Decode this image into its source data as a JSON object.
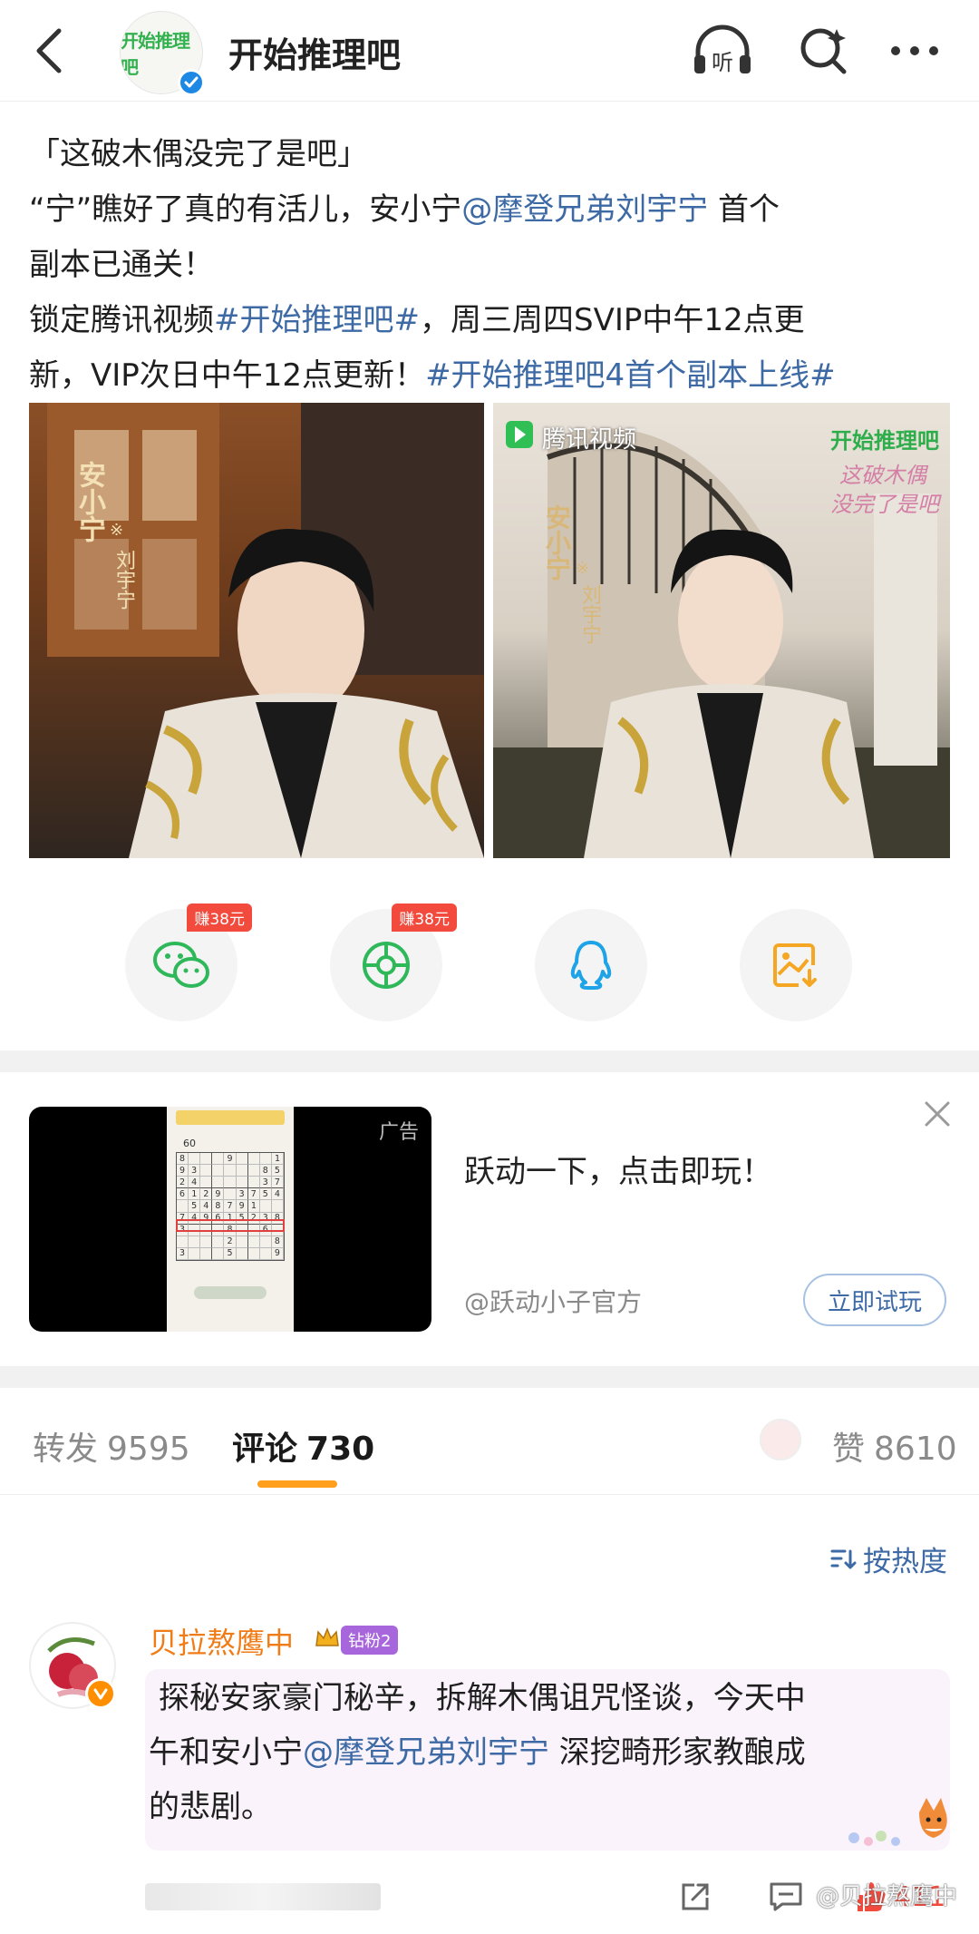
{
  "header": {
    "avatar_text": "开始推理吧",
    "title": "开始推理吧",
    "listen_label": "听"
  },
  "post": {
    "line1": "「这破木偶没完了是吧」",
    "line2_a": "“宁”瞧好了真的有活儿，安小宁",
    "line2_mention": "@摩登兄弟刘宇宁",
    "line2_b": " 首个",
    "line3": "副本已通关！",
    "line4_a": "锁定腾讯视频",
    "line4_tag": "#开始推理吧#",
    "line4_b": "，周三周四SVIP中午12点更",
    "line5_a": "新，VIP次日中午12点更新！",
    "line5_tag": "#开始推理吧4首个副本上线#"
  },
  "images": {
    "img1": {
      "role": "安小宁",
      "actor": "刘宇宁",
      "mark": "※"
    },
    "img2": {
      "role": "安小宁",
      "actor": "刘宇宁",
      "mark": "※",
      "brand": "腾讯视频",
      "logo": "开始推理吧",
      "slogan_1": "这破木偶",
      "slogan_2": "没完了是吧"
    }
  },
  "share": {
    "earn_label": "赚38元",
    "icons": [
      "wechat-icon",
      "moments-icon",
      "qq-icon",
      "save-image-icon"
    ]
  },
  "ad": {
    "label": "广告",
    "title": "跃动一下，点击即玩！",
    "source": "@跃动小子官方",
    "button": "立即试玩",
    "game_top": "60",
    "sudoku_rows": [
      "8   9   1",
      "93     85",
      "24     37",
      "6129 3754",
      " 548791  ",
      "749615238",
      "3   8  6 ",
      "    2   8",
      "3   5   9"
    ]
  },
  "tabs": {
    "repost_label": "转发",
    "repost_count": "9595",
    "comment_label": "评论",
    "comment_count": "730",
    "like_label": "赞",
    "like_count": "8610"
  },
  "sort": {
    "label": "按热度"
  },
  "comment": {
    "name": "贝拉熬鹰中",
    "fan_badge": "钻粉2",
    "line1": "探秘安家豪门秘辛，拆解木偶诅咒怪谈，今天中",
    "line2_a": "午和安小宁",
    "line2_mention": "@摩登兄弟刘宇宁",
    "line2_b": " 深挖畸形家教酿成",
    "line3": "的悲剧。",
    "like_count": "411"
  },
  "watermark": "@贝拉熬鹰中",
  "colors": {
    "link": "#3d6aa5",
    "accent": "#ff9f1c",
    "name": "#f07c18",
    "earn": "#f24a3d"
  }
}
